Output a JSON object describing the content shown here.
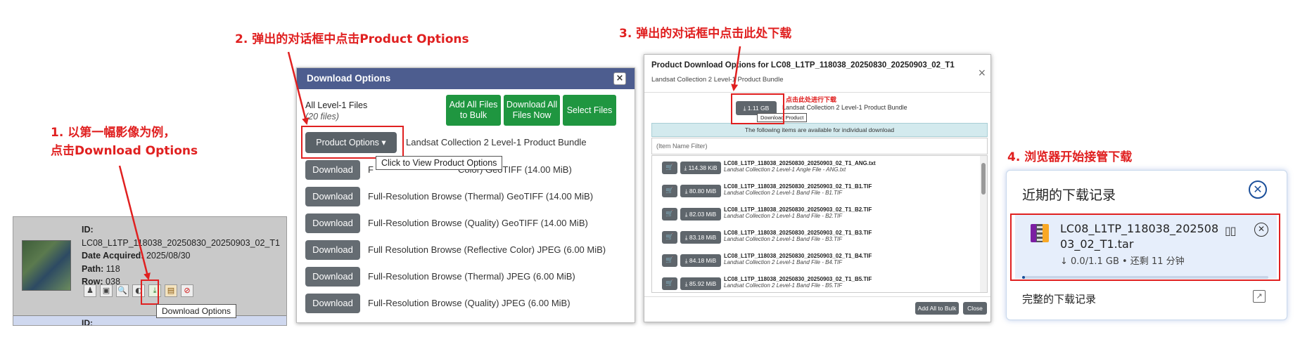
{
  "captions": {
    "step1_line1": "1. 以第一幅影像为例，",
    "step1_line2": "点击Download Options",
    "step2": "2. 弹出的对话框中点击Product Options",
    "step3": "3. 弹出的对话框中点击此处下载",
    "step4": "4. 浏览器开始接管下载"
  },
  "panel1": {
    "id_label": "ID:",
    "id_value": "LC08_L1TP_118038_20250830_20250903_02_T1",
    "date_label": "Date Acquired:",
    "date_value": "2025/08/30",
    "path_label": "Path:",
    "path_value": "118",
    "row_label": "Row:",
    "row_value": "038",
    "next_id_label": "ID:",
    "tooltip": "Download Options"
  },
  "panel2": {
    "header": "Download Options",
    "close": "×",
    "summary_line1": "All Level-1 Files",
    "summary_line2": "(20 files)",
    "btn_add_bulk_1": "Add All Files",
    "btn_add_bulk_2": "to Bulk",
    "btn_download_now_1": "Download All",
    "btn_download_now_2": "Files Now",
    "btn_select": "Select Files",
    "product_options_label": "Product Options",
    "product_bundle_text": "Landsat Collection 2 Level-1 Product Bundle",
    "tooltip": "Click to View Product Options",
    "download_label": "Download",
    "rows": [
      "F                                Color) GeoTIFF (14.00 MiB)",
      "Full-Resolution Browse (Thermal) GeoTIFF (14.00 MiB)",
      "Full-Resolution Browse (Quality) GeoTIFF (14.00 MiB)",
      "Full Resolution Browse (Reflective Color) JPEG (6.00 MiB)",
      "Full-Resolution Browse (Thermal) JPEG (6.00 MiB)",
      "Full-Resolution Browse (Quality) JPEG (6.00 MiB)"
    ],
    "row0_visible_prefix": "F",
    "row0_visible_suffix": "Color) GeoTIFF (14.00 MiB)"
  },
  "panel3": {
    "title": "Product Download Options for LC08_L1TP_118038_20250830_20250903_02_T1",
    "subtitle": "Landsat Collection 2 Level-1 Product Bundle",
    "close": "×",
    "bundle_size": "1.11 GB",
    "bundle_text": "Landsat Collection 2 Level-1 Product Bundle",
    "bundle_tooltip": "Download Product",
    "annotation": "点击此处进行下载",
    "avail_text": "The following items are available for individual download",
    "filter_placeholder": "(Item Name Filter)",
    "files": [
      {
        "size": "114.38 KiB",
        "name": "LC08_L1TP_118038_20250830_20250903_02_T1_ANG.txt",
        "desc": "Landsat Collection 2 Level-1 Angle File - ANG.txt"
      },
      {
        "size": "80.80 MiB",
        "name": "LC08_L1TP_118038_20250830_20250903_02_T1_B1.TIF",
        "desc": "Landsat Collection 2 Level-1 Band File - B1.TIF"
      },
      {
        "size": "82.03 MiB",
        "name": "LC08_L1TP_118038_20250830_20250903_02_T1_B2.TIF",
        "desc": "Landsat Collection 2 Level-1 Band File - B2.TIF"
      },
      {
        "size": "83.18 MiB",
        "name": "LC08_L1TP_118038_20250830_20250903_02_T1_B3.TIF",
        "desc": "Landsat Collection 2 Level-1 Band File - B3.TIF"
      },
      {
        "size": "84.18 MiB",
        "name": "LC08_L1TP_118038_20250830_20250903_02_T1_B4.TIF",
        "desc": "Landsat Collection 2 Level-1 Band File - B4.TIF"
      },
      {
        "size": "85.92 MiB",
        "name": "LC08_L1TP_118038_20250830_20250903_02_T1_B5.TIF",
        "desc": "Landsat Collection 2 Level-1 Band File - B5.TIF"
      }
    ],
    "btn_add_bulk": "Add All to Bulk",
    "btn_close": "Close"
  },
  "panel4": {
    "title": "近期的下载记录",
    "file_name": "LC08_L1TP_118038_20250803_02_T1.tar",
    "file_name_line1": "LC08_L1TP_118038_202508",
    "file_name_line2": "03_02_T1.tar",
    "status": "↓ 0.0/1.1 GB • 还剩 11 分钟",
    "progress": 0.01,
    "full_history": "完整的下载记录"
  },
  "colors": {
    "annotation_red": "#e02020",
    "dialog_header": "#4d5d8f",
    "green_button": "#1f9640",
    "gray_button": "#656c72"
  }
}
